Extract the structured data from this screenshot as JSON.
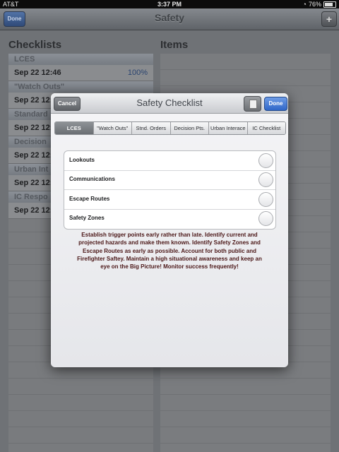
{
  "status": {
    "carrier": "AT&T",
    "time": "3:37 PM",
    "battery": "76%",
    "battery_level": 0.76
  },
  "nav": {
    "title": "Safety",
    "done_label": "Done",
    "add_label": "+"
  },
  "left": {
    "title": "Checklists",
    "sections": [
      {
        "header": "LCES",
        "row": "Sep 22 12:46",
        "pct": "100%"
      },
      {
        "header": "\"Watch Outs\"",
        "row": "Sep 22 12:",
        "pct": ""
      },
      {
        "header": "Standard",
        "row": "Sep 22 12:",
        "pct": ""
      },
      {
        "header": "Decision",
        "row": "Sep 22 12:",
        "pct": ""
      },
      {
        "header": "Urban Int",
        "row": "Sep 22 12:",
        "pct": ""
      },
      {
        "header": "IC Respo",
        "row": "Sep 22 12:",
        "pct": ""
      }
    ]
  },
  "right": {
    "title": "Items"
  },
  "modal": {
    "title": "Safety Checklist",
    "cancel_label": "Cancel",
    "done_label": "Done",
    "tabs": [
      "LCES",
      "\"Watch Outs\"",
      "Stnd. Orders",
      "Decision Pts.",
      "Urban Interace",
      "IC Checklist"
    ],
    "active_tab": 0,
    "items": [
      {
        "label": "Lookouts",
        "checked": false
      },
      {
        "label": "Communications",
        "checked": false
      },
      {
        "label": "Escape Routes",
        "checked": false
      },
      {
        "label": "Safety Zones",
        "checked": false
      }
    ],
    "description": "Establish trigger points early rather than late.  Identify current and projected hazards and make them known.  Identify Safety Zones and Escape Routes as early as possible.  Account for both public and Firefighter Saftey.  Maintain a high situational awareness and keep an eye on the Big Picture!  Monitor success frequently!"
  },
  "icons": {
    "document": "document-icon",
    "battery": "battery-icon",
    "lock": "lock-rotation-icon"
  }
}
